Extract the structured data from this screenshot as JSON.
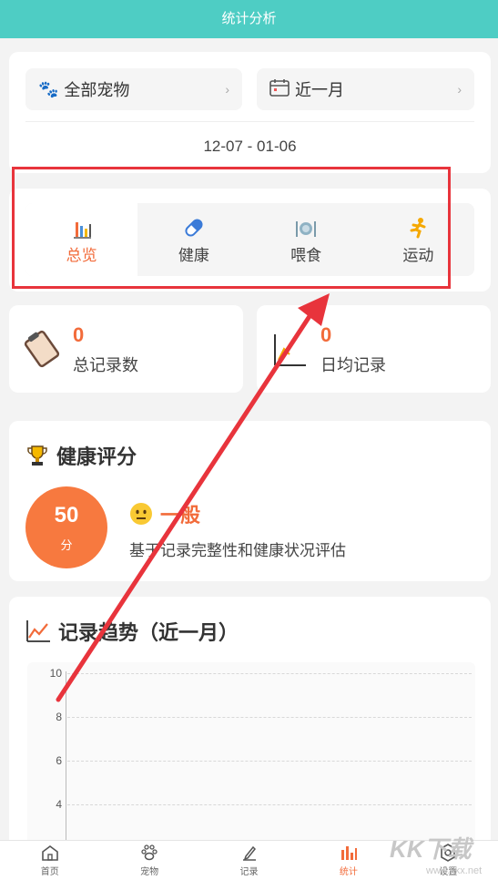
{
  "header": {
    "title": "统计分析"
  },
  "filters": {
    "pet": {
      "label": "全部宠物",
      "icon": "paw-icon"
    },
    "range": {
      "label": "近一月",
      "icon": "calendar-icon"
    },
    "chevron": "›",
    "date_range": "12-07 - 01-06"
  },
  "tabs": [
    {
      "label": "总览",
      "icon": "bar-chart-icon",
      "active": true
    },
    {
      "label": "健康",
      "icon": "pill-icon"
    },
    {
      "label": "喂食",
      "icon": "dining-icon"
    },
    {
      "label": "运动",
      "icon": "running-icon"
    }
  ],
  "stats": [
    {
      "value": "0",
      "label": "总记录数",
      "icon": "clipboard-icon"
    },
    {
      "value": "0",
      "label": "日均记录",
      "icon": "chart-axis-icon"
    }
  ],
  "health": {
    "title": "健康评分",
    "icon": "trophy-icon",
    "score": "50",
    "unit": "分",
    "level": "一般",
    "level_icon": "neutral-face-icon",
    "description": "基于记录完整性和健康状况评估"
  },
  "trend": {
    "title": "记录趋势（近一月）",
    "icon": "line-chart-icon"
  },
  "chart_data": {
    "type": "line",
    "title": "",
    "xlabel": "",
    "ylabel": "",
    "ylim": [
      0,
      10
    ],
    "yticks": [
      "10",
      "8",
      "6",
      "4"
    ],
    "series": [],
    "grid": true
  },
  "nav": [
    {
      "label": "首页",
      "icon": "home-icon"
    },
    {
      "label": "宠物",
      "icon": "paw-icon"
    },
    {
      "label": "记录",
      "icon": "pencil-icon"
    },
    {
      "label": "统计",
      "icon": "bar-chart-icon",
      "active": true
    },
    {
      "label": "设置",
      "icon": "gear-icon"
    }
  ],
  "watermark": {
    "text": "KK下载",
    "sub": "www.kkx.net"
  },
  "colors": {
    "accent": "#f26b3a",
    "header": "#4ecdc4",
    "annotation": "#e8343c"
  }
}
